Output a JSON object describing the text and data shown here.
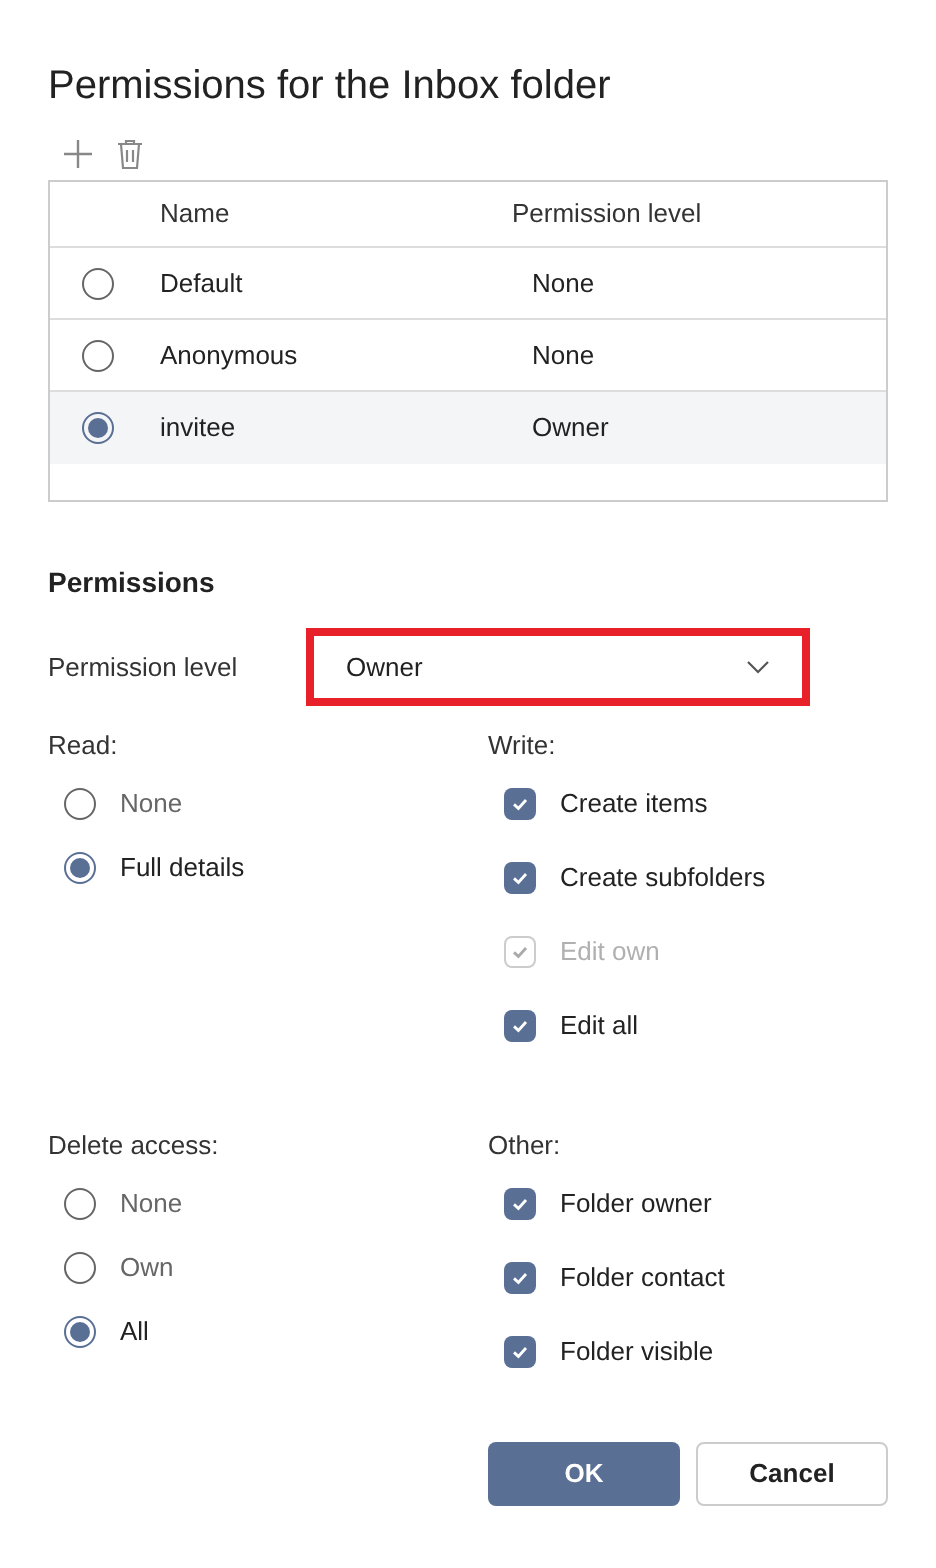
{
  "dialog": {
    "title": "Permissions for the Inbox folder"
  },
  "table": {
    "columns": [
      "Name",
      "Permission level"
    ],
    "rows": [
      {
        "name": "Default",
        "level": "None",
        "selected": false
      },
      {
        "name": "Anonymous",
        "level": "None",
        "selected": false
      },
      {
        "name": "invitee",
        "level": "Owner",
        "selected": true
      }
    ]
  },
  "permissions": {
    "heading": "Permissions",
    "level_label": "Permission level",
    "level_value": "Owner",
    "highlighted": true,
    "read": {
      "label": "Read:",
      "options": [
        {
          "label": "None",
          "selected": false
        },
        {
          "label": "Full details",
          "selected": true
        }
      ]
    },
    "write": {
      "label": "Write:",
      "options": [
        {
          "label": "Create items",
          "checked": true,
          "disabled": false
        },
        {
          "label": "Create subfolders",
          "checked": true,
          "disabled": false
        },
        {
          "label": "Edit own",
          "checked": true,
          "disabled": true
        },
        {
          "label": "Edit all",
          "checked": true,
          "disabled": false
        }
      ]
    },
    "delete": {
      "label": "Delete access:",
      "options": [
        {
          "label": "None",
          "selected": false
        },
        {
          "label": "Own",
          "selected": false
        },
        {
          "label": "All",
          "selected": true
        }
      ]
    },
    "other": {
      "label": "Other:",
      "options": [
        {
          "label": "Folder owner",
          "checked": true,
          "disabled": false
        },
        {
          "label": "Folder contact",
          "checked": true,
          "disabled": false
        },
        {
          "label": "Folder visible",
          "checked": true,
          "disabled": false
        }
      ]
    }
  },
  "buttons": [
    "OK",
    "Cancel"
  ]
}
